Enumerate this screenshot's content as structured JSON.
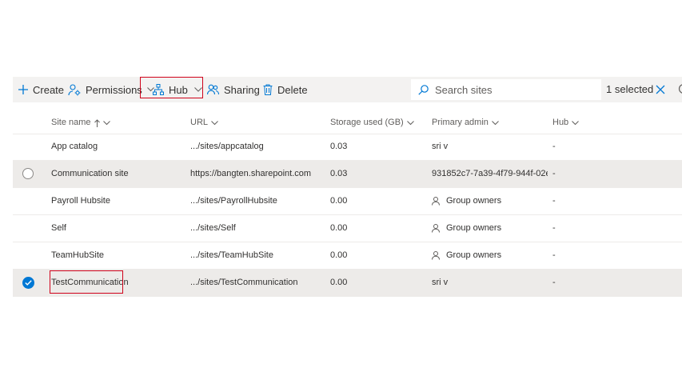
{
  "toolbar": {
    "create_label": "Create",
    "permissions_label": "Permissions",
    "hub_label": "Hub",
    "sharing_label": "Sharing",
    "delete_label": "Delete",
    "search_placeholder": "Search sites",
    "selected_text": "1 selected",
    "highlight_color": "#d0021b"
  },
  "table": {
    "columns": [
      "Site name",
      "URL",
      "Storage used (GB)",
      "Primary admin",
      "Hub"
    ],
    "rows": [
      {
        "name": "App catalog",
        "url": ".../sites/appcatalog",
        "storage": "0.03",
        "admin": "sri v",
        "admin_is_group": false,
        "hub": "-",
        "state": "none"
      },
      {
        "name": "Communication site",
        "url": "https://bangten.sharepoint.com",
        "storage": "0.03",
        "admin": "931852c7-7a39-4f79-944f-02e...",
        "admin_is_group": false,
        "hub": "-",
        "state": "unchecked"
      },
      {
        "name": "Payroll Hubsite",
        "url": ".../sites/PayrollHubsite",
        "storage": "0.00",
        "admin": "Group owners",
        "admin_is_group": true,
        "hub": "-",
        "state": "none"
      },
      {
        "name": "Self",
        "url": ".../sites/Self",
        "storage": "0.00",
        "admin": "Group owners",
        "admin_is_group": true,
        "hub": "-",
        "state": "none"
      },
      {
        "name": "TeamHubSite",
        "url": ".../sites/TeamHubSite",
        "storage": "0.00",
        "admin": "Group owners",
        "admin_is_group": true,
        "hub": "-",
        "state": "none"
      },
      {
        "name": "TestCommunication",
        "url": ".../sites/TestCommunication",
        "storage": "0.00",
        "admin": "sri v",
        "admin_is_group": false,
        "hub": "-",
        "state": "checked"
      }
    ]
  },
  "colors": {
    "accent": "#0078d4",
    "toolbar_bg": "#f3f2f1",
    "selected_row_bg": "#edebe9"
  }
}
